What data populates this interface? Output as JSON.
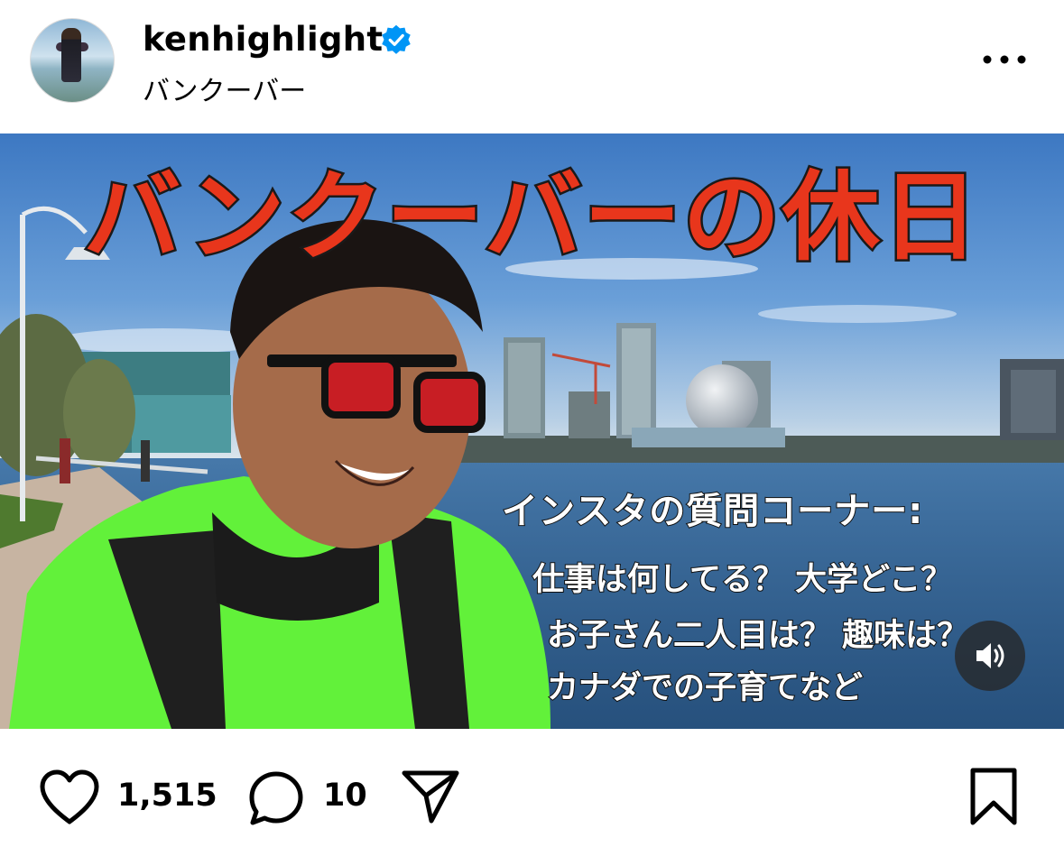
{
  "post": {
    "username": "kenhighlight",
    "verified": true,
    "location": "バンクーバー",
    "more_label": "•••"
  },
  "media": {
    "title": "バンクーバーの休日",
    "qa_heading": "インスタの質問コーナー:",
    "qa_lines": [
      "仕事は何してる？ 大学どこ？",
      "お子さん二人目は？ 趣味は？",
      "カナダでの子育てなど"
    ],
    "audio_icon": "speaker-icon",
    "title_color": "#e8361c",
    "hoodie_color": "#62f13a"
  },
  "actions": {
    "like_count": "1,515",
    "comment_count": "10",
    "icons": [
      "heart-icon",
      "comment-icon",
      "share-icon",
      "bookmark-icon"
    ]
  },
  "colors": {
    "verified_blue": "#0095f6",
    "text": "#000000"
  }
}
